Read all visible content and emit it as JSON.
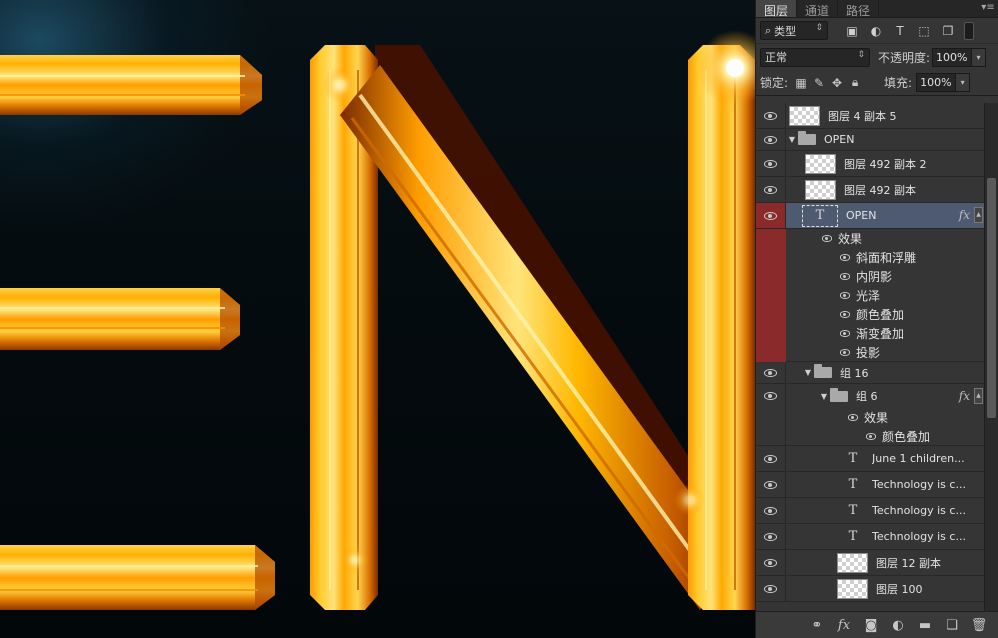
{
  "canvas": {
    "letters": [
      "E",
      "N"
    ],
    "colors": {
      "gold_light": "#ffe066",
      "gold": "#ffb300",
      "orange": "#e07a00",
      "dark": "#6a2400",
      "bg": "#03090c"
    }
  },
  "panel": {
    "tabs": [
      {
        "label": "图层",
        "active": true
      },
      {
        "label": "通道",
        "active": false
      },
      {
        "label": "路径",
        "active": false
      }
    ],
    "filter": {
      "kind_label": "类型"
    },
    "blend_mode": "正常",
    "opacity_label": "不透明度:",
    "opacity_value": "100%",
    "lock_label": "锁定:",
    "fill_label": "填充:",
    "fill_value": "100%"
  },
  "layers": [
    {
      "name": "图层 4 副本 5"
    },
    {
      "name": "OPEN",
      "group": true
    },
    {
      "name": "图层 492 副本 2"
    },
    {
      "name": "图层 492 副本"
    },
    {
      "name": "OPEN",
      "text": true,
      "selected": true
    },
    {
      "name": "组 16",
      "group": true
    },
    {
      "name": "组 6",
      "group": true
    },
    {
      "name": "June 1 children..."
    },
    {
      "name": "Technology is c..."
    },
    {
      "name": "Technology is c..."
    },
    {
      "name": "Technology is c..."
    },
    {
      "name": "图层 12 副本"
    },
    {
      "name": "图层 100"
    }
  ],
  "effects_open": {
    "header": "效果",
    "items": [
      "斜面和浮雕",
      "内阴影",
      "光泽",
      "颜色叠加",
      "渐变叠加",
      "投影"
    ]
  },
  "effects_group6": {
    "header": "效果",
    "items": [
      "颜色叠加"
    ]
  },
  "fx_label": "fx"
}
